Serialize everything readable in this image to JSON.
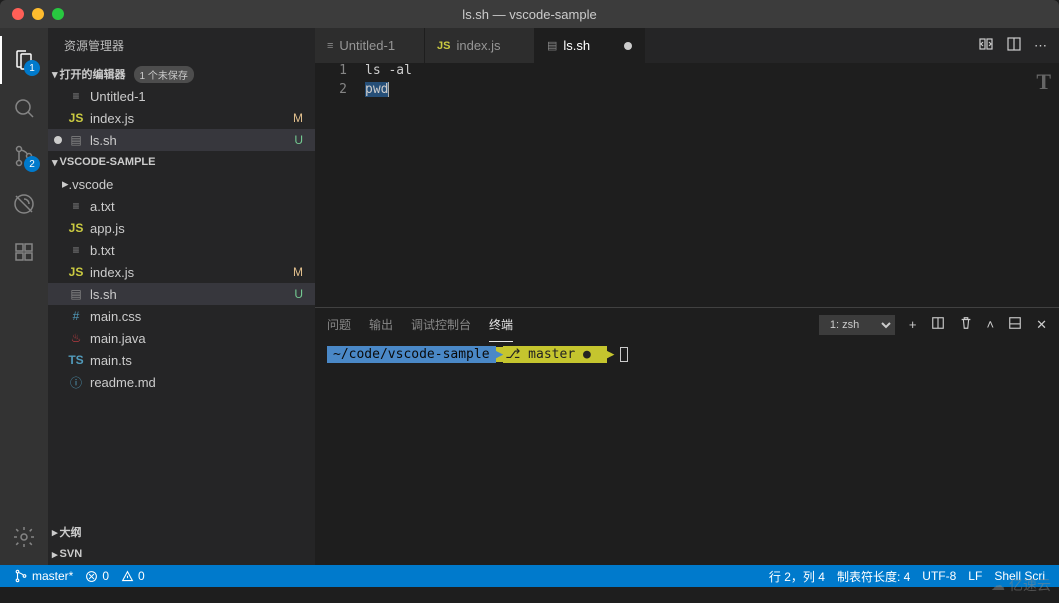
{
  "window": {
    "title": "ls.sh — vscode-sample"
  },
  "activity": {
    "explorer_badge": "1",
    "scm_badge": "2"
  },
  "sidebar": {
    "title": "资源管理器",
    "open_editors": {
      "label": "打开的编辑器",
      "badge": "1 个未保存",
      "items": [
        {
          "label": "Untitled-1",
          "status": ""
        },
        {
          "label": "index.js",
          "status": "M"
        },
        {
          "label": "ls.sh",
          "status": "U"
        }
      ]
    },
    "workspace": {
      "label": "VSCODE-SAMPLE",
      "items": [
        {
          "label": ".vscode",
          "kind": "folder",
          "status": ""
        },
        {
          "label": "a.txt",
          "kind": "txt",
          "status": ""
        },
        {
          "label": "app.js",
          "kind": "js",
          "status": ""
        },
        {
          "label": "b.txt",
          "kind": "txt",
          "status": ""
        },
        {
          "label": "index.js",
          "kind": "js",
          "status": "M"
        },
        {
          "label": "ls.sh",
          "kind": "sh",
          "status": "U"
        },
        {
          "label": "main.css",
          "kind": "css",
          "status": ""
        },
        {
          "label": "main.java",
          "kind": "java",
          "status": ""
        },
        {
          "label": "main.ts",
          "kind": "ts",
          "status": ""
        },
        {
          "label": "readme.md",
          "kind": "info",
          "status": ""
        }
      ]
    },
    "outline_label": "大纲",
    "svn_label": "SVN"
  },
  "tabs": [
    {
      "label": "Untitled-1",
      "kind": "txt",
      "active": false
    },
    {
      "label": "index.js",
      "kind": "js",
      "active": false
    },
    {
      "label": "ls.sh",
      "kind": "sh",
      "active": true,
      "dirty": true
    }
  ],
  "editor": {
    "lines": [
      {
        "num": "1",
        "text": "ls -al"
      },
      {
        "num": "2",
        "text": "pwd"
      }
    ]
  },
  "panel": {
    "tabs": {
      "problems": "问题",
      "output": "输出",
      "debug": "调试控制台",
      "terminal": "终端"
    },
    "shell_select": "1: zsh",
    "prompt_path": "~/code/vscode-sample",
    "prompt_branch": " master ● "
  },
  "statusbar": {
    "branch": "master*",
    "errors": "0",
    "warnings": "0",
    "cursor": "行 2，列 4",
    "tab_size": "制表符长度: 4",
    "encoding": "UTF-8",
    "eol": "LF",
    "lang": "Shell Scri"
  },
  "watermark": "亿速云"
}
